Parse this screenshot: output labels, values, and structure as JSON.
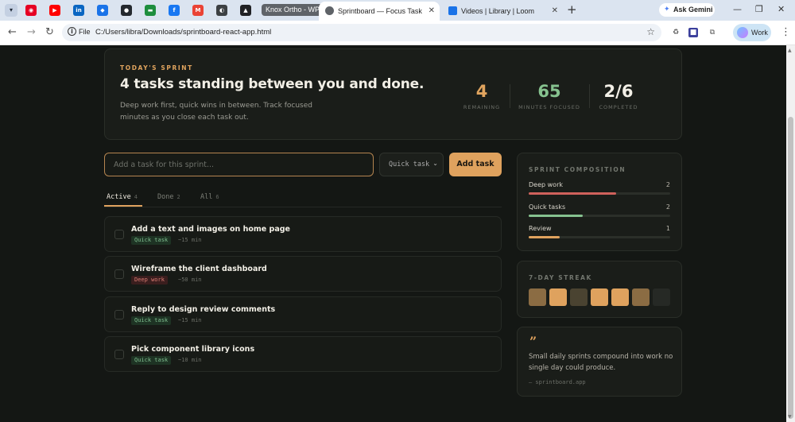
{
  "browser": {
    "tab_dropdown_icon": "chevron-down-icon",
    "pinned_tabs": [
      {
        "name": "pinterest-icon",
        "color": "#e60023",
        "glyph": "◉"
      },
      {
        "name": "youtube-icon",
        "color": "#ff0000",
        "glyph": "▶"
      },
      {
        "name": "linkedin-icon",
        "color": "#0a66c2",
        "glyph": "in"
      },
      {
        "name": "app-icon",
        "color": "#1a73e8",
        "glyph": "◆"
      },
      {
        "name": "github-icon",
        "color": "#24292f",
        "glyph": "●"
      },
      {
        "name": "meet-icon",
        "color": "#1e8e3e",
        "glyph": "▬"
      },
      {
        "name": "facebook-icon",
        "color": "#1877f2",
        "glyph": "f"
      },
      {
        "name": "gmail-icon",
        "color": "#ea4335",
        "glyph": "M"
      },
      {
        "name": "app-icon-2",
        "color": "#3c4043",
        "glyph": "◐"
      },
      {
        "name": "app-icon-3",
        "color": "#202124",
        "glyph": "▲"
      }
    ],
    "tab_group": "Knox Ortho - WP",
    "tabs": [
      {
        "title": "Sprintboard — Focus Task Man",
        "active": true,
        "favicon_color": "#5f6368"
      },
      {
        "title": "Videos | Library | Loom",
        "active": false,
        "favicon_color": "#1a73e8"
      }
    ],
    "new_tab_label": "+",
    "ask_gemini": "Ask Gemini",
    "window_controls": {
      "minimize": "—",
      "restore": "❐",
      "close": "✕"
    },
    "address": {
      "scheme_label": "File",
      "url": "C:/Users/libra/Downloads/sprintboard-react-app.html"
    },
    "profile_label": "Work"
  },
  "hero": {
    "eyebrow": "TODAY'S SPRINT",
    "title": "4 tasks standing between you and done.",
    "description": "Deep work first, quick wins in between. Track focused minutes as you close each task out.",
    "stats": [
      {
        "value": "4",
        "label": "REMAINING",
        "color": "#e0a45e"
      },
      {
        "value": "65",
        "label": "MINUTES FOCUSED",
        "color": "#86c28f"
      },
      {
        "value": "2/6",
        "label": "COMPLETED",
        "color": "#f2efe6"
      }
    ]
  },
  "composer": {
    "placeholder": "Add a task for this sprint...",
    "type_value": "Quick task",
    "add_label": "Add task"
  },
  "filters": [
    {
      "label": "Active",
      "count": "4",
      "active": true
    },
    {
      "label": "Done",
      "count": "2",
      "active": false
    },
    {
      "label": "All",
      "count": "6",
      "active": false
    }
  ],
  "tasks": [
    {
      "title": "Add a text and images on home page",
      "tag": "Quick task",
      "tag_kind": "quick",
      "estimate": "~15 min"
    },
    {
      "title": "Wireframe the client dashboard",
      "tag": "Deep work",
      "tag_kind": "deep",
      "estimate": "~50 min"
    },
    {
      "title": "Reply to design review comments",
      "tag": "Quick task",
      "tag_kind": "quick",
      "estimate": "~15 min"
    },
    {
      "title": "Pick component library icons",
      "tag": "Quick task",
      "tag_kind": "quick",
      "estimate": "~10 min"
    }
  ],
  "composition": {
    "title": "SPRINT COMPOSITION",
    "rows": [
      {
        "label": "Deep work",
        "count": "2",
        "fraction": 0.62,
        "color": "#d0625c"
      },
      {
        "label": "Quick tasks",
        "count": "2",
        "fraction": 0.38,
        "color": "#86c28f"
      },
      {
        "label": "Review",
        "count": "1",
        "fraction": 0.22,
        "color": "#dfa25e"
      }
    ]
  },
  "streak": {
    "title": "7-DAY STREAK",
    "days": [
      "#8b6c43",
      "#dfa25e",
      "#4a4331",
      "#dfa25e",
      "#dfa25e",
      "#8b6c43",
      "#262925"
    ]
  },
  "quote": {
    "mark": "”",
    "text": "Small daily sprints compound into work no single day could produce.",
    "source": "— sprintboard.app"
  }
}
